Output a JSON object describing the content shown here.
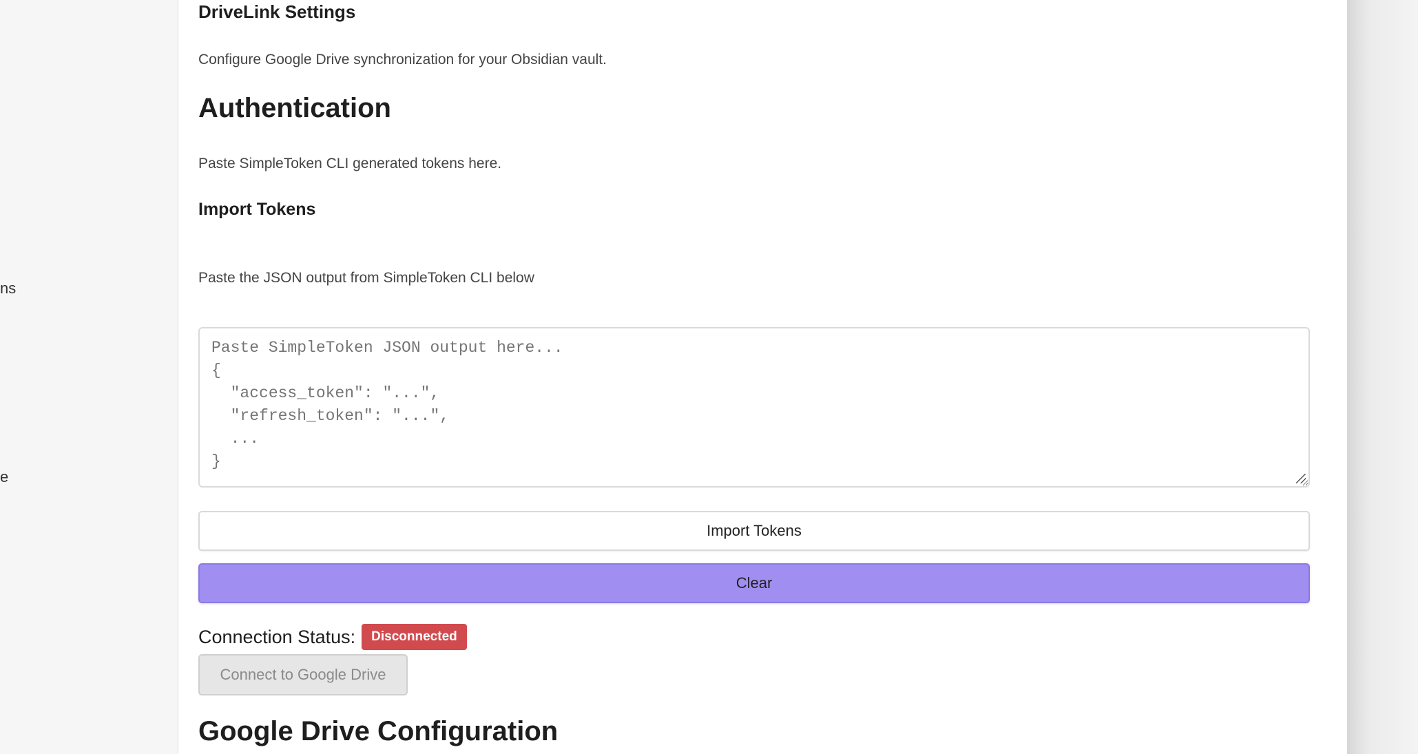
{
  "sidebar": {
    "fragment_1": "ns",
    "fragment_2": "e"
  },
  "settings": {
    "title": "DriveLink Settings",
    "description": "Configure Google Drive synchronization for your Obsidian vault.",
    "auth": {
      "heading": "Authentication",
      "description": "Paste SimpleToken CLI generated tokens here.",
      "import_heading": "Import Tokens",
      "import_description": "Paste the JSON output from SimpleToken CLI below",
      "textarea_placeholder": "Paste SimpleToken JSON output here...\n{\n  \"access_token\": \"...\",\n  \"refresh_token\": \"...\",\n  ...\n}",
      "textarea_value": "",
      "import_button": "Import Tokens",
      "clear_button": "Clear",
      "status_label": "Connection Status:",
      "status_badge": "Disconnected",
      "connect_button": "Connect to Google Drive"
    },
    "drive_config_heading": "Google Drive Configuration"
  },
  "colors": {
    "accent": "#a08ff0",
    "status_disconnected": "#d14a4e"
  }
}
